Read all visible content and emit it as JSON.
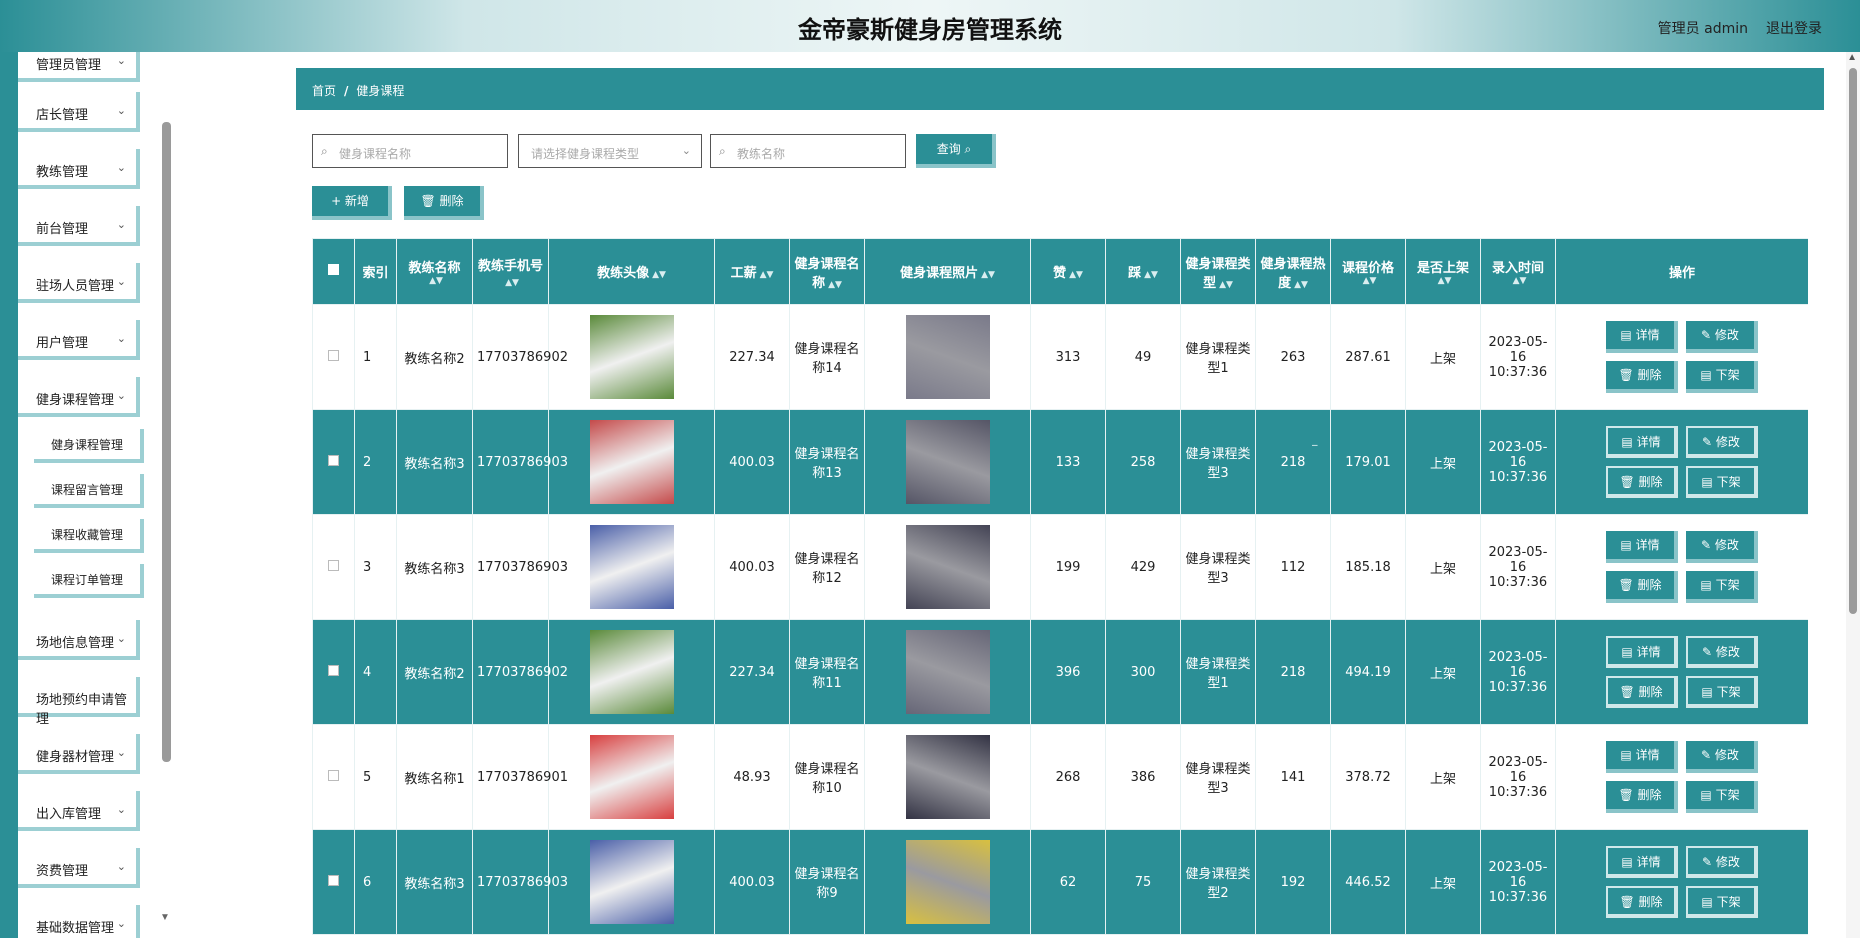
{
  "header": {
    "title": "金帝豪斯健身房管理系统",
    "user": "管理员 admin",
    "logout": "退出登录"
  },
  "sidebar": {
    "items": [
      {
        "label": "管理员管理"
      },
      {
        "label": "店长管理"
      },
      {
        "label": "教练管理"
      },
      {
        "label": "前台管理"
      },
      {
        "label": "驻场人员管理"
      },
      {
        "label": "用户管理"
      },
      {
        "label": "健身课程管理"
      }
    ],
    "subitems": [
      {
        "label": "健身课程管理"
      },
      {
        "label": "课程留言管理"
      },
      {
        "label": "课程收藏管理"
      },
      {
        "label": "课程订单管理"
      }
    ],
    "items2": [
      {
        "label": "场地信息管理"
      },
      {
        "label": "场地预约申请管理"
      },
      {
        "label": "健身器材管理"
      },
      {
        "label": "出入库管理"
      },
      {
        "label": "资费管理"
      },
      {
        "label": "基础数据管理"
      }
    ]
  },
  "breadcrumb": {
    "home": "首页",
    "sep": "/",
    "current": "健身课程"
  },
  "search": {
    "course_name_placeholder": "健身课程名称",
    "course_type_placeholder": "请选择健身课程类型",
    "coach_name_placeholder": "教练名称",
    "query_label": "查询"
  },
  "actions": {
    "add_label": "+ 新增",
    "delete_label": "删除"
  },
  "table": {
    "headers": [
      "索引",
      "教练名称",
      "教练手机号",
      "教练头像",
      "工薪",
      "健身课程名称",
      "健身课程照片",
      "赞",
      "踩",
      "健身课程类型",
      "健身课程热度",
      "课程价格",
      "是否上架",
      "录入时间",
      "操作"
    ],
    "op_labels": {
      "detail": "详情",
      "edit": "修改",
      "delete": "删除",
      "offshelf": "下架"
    },
    "rows": [
      {
        "index": "1",
        "coach": "教练名称2",
        "phone": "17703786902",
        "salary": "227.34",
        "course": "健身课程名称14",
        "likes": "313",
        "dislikes": "49",
        "type": "健身课程类型1",
        "heat": "263",
        "price": "287.61",
        "onshelf": "上架",
        "time": "2023-05-16 10:37:36"
      },
      {
        "index": "2",
        "coach": "教练名称3",
        "phone": "17703786903",
        "salary": "400.03",
        "course": "健身课程名称13",
        "likes": "133",
        "dislikes": "258",
        "type": "健身课程类型3",
        "heat": "218",
        "price": "179.01",
        "onshelf": "上架",
        "time": "2023-05-16 10:37:36"
      },
      {
        "index": "3",
        "coach": "教练名称3",
        "phone": "17703786903",
        "salary": "400.03",
        "course": "健身课程名称12",
        "likes": "199",
        "dislikes": "429",
        "type": "健身课程类型3",
        "heat": "112",
        "price": "185.18",
        "onshelf": "上架",
        "time": "2023-05-16 10:37:36"
      },
      {
        "index": "4",
        "coach": "教练名称2",
        "phone": "17703786902",
        "salary": "227.34",
        "course": "健身课程名称11",
        "likes": "396",
        "dislikes": "300",
        "type": "健身课程类型1",
        "heat": "218",
        "price": "494.19",
        "onshelf": "上架",
        "time": "2023-05-16 10:37:36"
      },
      {
        "index": "5",
        "coach": "教练名称1",
        "phone": "17703786901",
        "salary": "48.93",
        "course": "健身课程名称10",
        "likes": "268",
        "dislikes": "386",
        "type": "健身课程类型3",
        "heat": "141",
        "price": "378.72",
        "onshelf": "上架",
        "time": "2023-05-16 10:37:36"
      },
      {
        "index": "6",
        "coach": "教练名称3",
        "phone": "17703786903",
        "salary": "400.03",
        "course": "健身课程名称9",
        "likes": "62",
        "dislikes": "75",
        "type": "健身课程类型2",
        "heat": "192",
        "price": "446.52",
        "onshelf": "上架",
        "time": "2023-05-16 10:37:36"
      }
    ]
  },
  "colors": {
    "accent": "#2b8f96",
    "accent_light": "#8ac4c9"
  }
}
